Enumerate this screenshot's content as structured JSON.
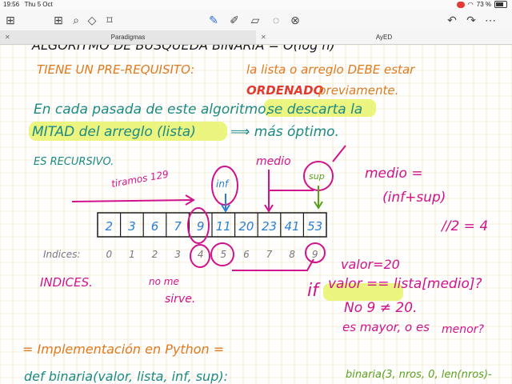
{
  "status": {
    "time": "19:56",
    "date": "Thu 5 Oct",
    "battery": "73 %"
  },
  "toolbar": {
    "icons": [
      "grid-icon",
      "search-icon",
      "shapes-icon",
      "bookmark-icon",
      "pen-icon",
      "highlighter-icon",
      "eraser-icon",
      "lasso-icon",
      "image-icon"
    ]
  },
  "tabs": [
    {
      "label": "Paradigmas",
      "active": false
    },
    {
      "label": "AyED",
      "active": true
    }
  ],
  "note": {
    "top_partial": "ALGORITMO DE BUSQUEDA BINARIA = O(log n)",
    "prereq_label": "TIENE UN PRE-REQUISITO:",
    "prereq_text": "la lista o arreglo DEBE estar",
    "ordenado": "ORDENADO",
    "previamente": "previamente.",
    "line1_a": "En cada pasada de este algoritmo,",
    "line1_b": "se descarta la",
    "line2_a": "MITAD del arreglo (lista)",
    "line2_b": "⟹ más óptimo.",
    "recursivo": "ES RECURSIVO.",
    "tiramos": "tiramos 129",
    "inf": "inf",
    "medio": "medio",
    "sup": "sup",
    "formula_1": "medio =",
    "formula_2": "(inf+sup)",
    "formula_3": "//2 = 4",
    "array_values": [
      "2",
      "3",
      "6",
      "7",
      "9",
      "11",
      "20",
      "23",
      "41",
      "53"
    ],
    "indices_label": "Indices:",
    "indices": [
      "0",
      "1",
      "2",
      "3",
      "4",
      "5",
      "6",
      "7",
      "8",
      "9"
    ],
    "indices_caps": "INDICES.",
    "no_me_sirve_1": "no me",
    "no_me_sirve_2": "sirve.",
    "valor20": "valor=20",
    "if_word": "if",
    "condition": "valor == lista[medio]?",
    "no_line": "No 9 ≠ 20.",
    "es_mayor": "es mayor, o es",
    "menor": "menor?",
    "impl": "= Implementación en Python =",
    "def_line": "def binaria(valor, lista, inf, sup):",
    "call_line": "binaria(3, nros, 0, len(nros)-"
  },
  "colors": {
    "black_ink": "#1a1a1a",
    "orange_ink": "#e07a1f",
    "teal_ink": "#1b8a84",
    "magenta_ink": "#d0138c",
    "red_ink": "#e33a2e",
    "blue_ink": "#2a7fd4",
    "green_ink": "#5aa01e",
    "highlight": "#e7f36a",
    "grid": "#f0dcb0"
  }
}
